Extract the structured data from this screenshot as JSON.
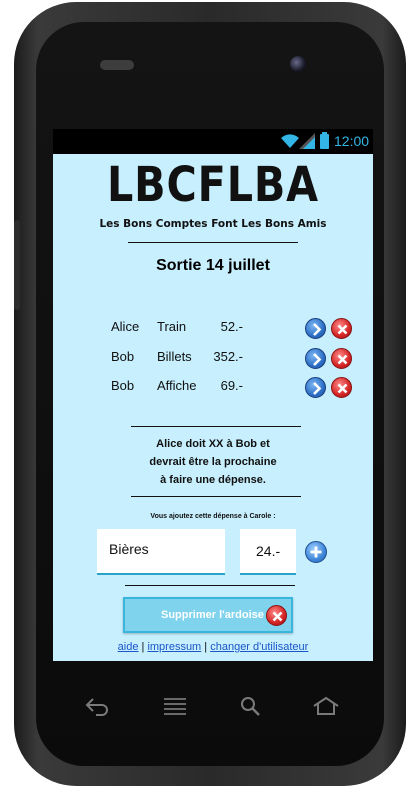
{
  "status": {
    "time": "12:00"
  },
  "app": {
    "logo": "LBCFLBA",
    "tagline": "Les Bons Comptes Font Les Bons Amis",
    "title": "Sortie 14 juillet"
  },
  "expenses": [
    {
      "name": "Alice",
      "desc": "Train",
      "amount": "52.-"
    },
    {
      "name": "Bob",
      "desc": "Billets",
      "amount": "352.-"
    },
    {
      "name": "Bob",
      "desc": "Affiche",
      "amount": "69.-"
    }
  ],
  "message": {
    "line1": "Alice doit XX à Bob et",
    "line2": "devrait être la prochaine",
    "line3": "à faire une dépense."
  },
  "form": {
    "label": "Vous ajoutez cette dépense à Carole :",
    "desc_value": "Bières",
    "amount_value": "24.-"
  },
  "reset_label": "Supprimer l'ardoise",
  "footer": {
    "help": "aide",
    "sep1": " | ",
    "print": "impressum",
    "sep2": " | ",
    "change_user": "changer d'utilisateur"
  },
  "colors": {
    "screen_bg": "#c7effd",
    "accent": "#33b5e5",
    "link": "#1a55c9"
  }
}
